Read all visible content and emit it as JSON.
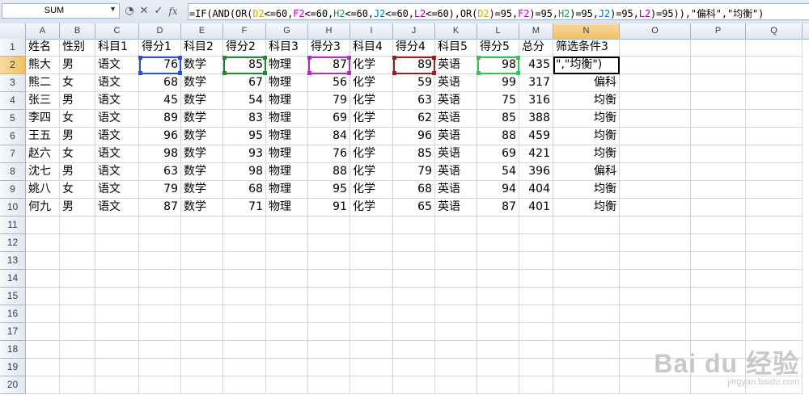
{
  "name_box": "SUM",
  "formula_icons": {
    "cancel": "✕",
    "enter": "✓",
    "fx": "fx"
  },
  "formula_segments": [
    {
      "t": "=IF(AND(OR(",
      "c": "#000000"
    },
    {
      "t": "D2",
      "c": "#c9b000"
    },
    {
      "t": "<=60,",
      "c": "#000000"
    },
    {
      "t": "F2",
      "c": "#c000c0"
    },
    {
      "t": "<=60,",
      "c": "#000000"
    },
    {
      "t": "H2",
      "c": "#2e8b57"
    },
    {
      "t": "<=60,",
      "c": "#000000"
    },
    {
      "t": "J2",
      "c": "#0070c0"
    },
    {
      "t": "<=60,",
      "c": "#000000"
    },
    {
      "t": "L2",
      "c": "#a000a0"
    },
    {
      "t": "<=60),OR(",
      "c": "#000000"
    },
    {
      "t": "D2",
      "c": "#c9b000"
    },
    {
      "t": ")=95,",
      "c": "#000000"
    },
    {
      "t": "F2",
      "c": "#c000c0"
    },
    {
      "t": ")=95,",
      "c": "#000000"
    },
    {
      "t": "H2",
      "c": "#2e8b57"
    },
    {
      "t": ")=95,",
      "c": "#000000"
    },
    {
      "t": "J2",
      "c": "#0070c0"
    },
    {
      "t": ")=95,",
      "c": "#000000"
    },
    {
      "t": "L2",
      "c": "#a000a0"
    },
    {
      "t": ")=95)),\"偏科\",\"均衡\")",
      "c": "#000000"
    }
  ],
  "columns": [
    "A",
    "B",
    "C",
    "D",
    "E",
    "F",
    "G",
    "H",
    "I",
    "J",
    "K",
    "L",
    "M",
    "N",
    "O",
    "P",
    "Q"
  ],
  "selected_column": "N",
  "selected_row": 2,
  "row_numbers": [
    "1",
    "2",
    "3",
    "4",
    "5",
    "6",
    "7",
    "8",
    "9",
    "10",
    "11",
    "12",
    "13",
    "14",
    "15",
    "16",
    "17",
    "18",
    "19",
    "20"
  ],
  "headers": [
    "姓名",
    "性别",
    "科目1",
    "得分1",
    "科目2",
    "得分2",
    "科目3",
    "得分3",
    "科目4",
    "得分4",
    "科目5",
    "得分5",
    "总分",
    "筛选条件3"
  ],
  "rows": [
    [
      "熊大",
      "男",
      "语文",
      "76",
      "数学",
      "85",
      "物理",
      "87",
      "化学",
      "89",
      "英语",
      "98",
      "435",
      "\",\"均衡\")"
    ],
    [
      "熊二",
      "女",
      "语文",
      "68",
      "数学",
      "67",
      "物理",
      "56",
      "化学",
      "59",
      "英语",
      "99",
      "317",
      "偏科"
    ],
    [
      "张三",
      "男",
      "语文",
      "45",
      "数学",
      "54",
      "物理",
      "79",
      "化学",
      "63",
      "英语",
      "75",
      "316",
      "均衡"
    ],
    [
      "李四",
      "女",
      "语文",
      "89",
      "数学",
      "83",
      "物理",
      "69",
      "化学",
      "62",
      "英语",
      "85",
      "388",
      "均衡"
    ],
    [
      "王五",
      "男",
      "语文",
      "96",
      "数学",
      "95",
      "物理",
      "84",
      "化学",
      "96",
      "英语",
      "88",
      "459",
      "均衡"
    ],
    [
      "赵六",
      "女",
      "语文",
      "98",
      "数学",
      "93",
      "物理",
      "76",
      "化学",
      "85",
      "英语",
      "69",
      "421",
      "均衡"
    ],
    [
      "沈七",
      "男",
      "语文",
      "63",
      "数学",
      "98",
      "物理",
      "88",
      "化学",
      "79",
      "英语",
      "54",
      "396",
      "偏科"
    ],
    [
      "姚八",
      "女",
      "语文",
      "79",
      "数学",
      "68",
      "物理",
      "95",
      "化学",
      "68",
      "英语",
      "94",
      "404",
      "均衡"
    ],
    [
      "何九",
      "男",
      "语文",
      "87",
      "数学",
      "71",
      "物理",
      "91",
      "化学",
      "65",
      "英语",
      "87",
      "401",
      "均衡"
    ]
  ],
  "ref_colors": {
    "D2": "#2b4fd8",
    "F2": "#1f8a2e",
    "H2": "#b02fc0",
    "J2": "#9a1f1f",
    "L2": "#33c45a"
  },
  "watermark": {
    "main": "Bai du 经验",
    "sub": "jingyan.baidu.com"
  }
}
